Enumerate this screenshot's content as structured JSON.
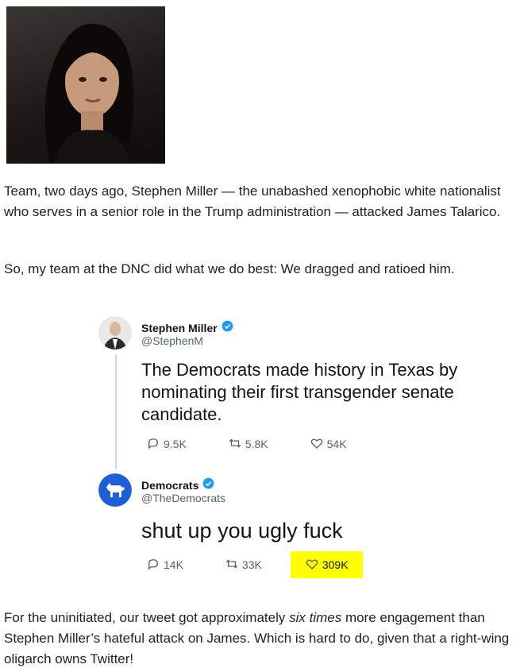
{
  "intro": {
    "paragraph1": "Team, two days ago, Stephen Miller — the unabashed xenophobic white nationalist who serves in a senior role in the Trump administration — attacked James Talarico.",
    "paragraph2": "So, my team at the DNC did what we do best: We dragged and ratioed him."
  },
  "tweets": [
    {
      "name": "Stephen Miller",
      "handle": "@StephenM",
      "text": "The Democrats made history in Texas by nominating their first transgender senate candidate.",
      "replies": "9.5K",
      "retweets": "5.8K",
      "likes": "54K"
    },
    {
      "name": "Democrats",
      "handle": "@TheDemocrats",
      "text": "shut up you ugly fuck",
      "replies": "14K",
      "retweets": "33K",
      "likes": "309K"
    }
  ],
  "outro": {
    "before": "For the uninitiated, our tweet got approximately ",
    "emphasis": "six times",
    "after": " more engagement than Stephen Miller’s hateful attack on James. Which is hard to do, given that a right-wing oligarch owns Twitter!"
  },
  "colors": {
    "verified": "#1d9bf0",
    "democrats_brand": "#1d5fd6",
    "highlight": "#ffff00"
  }
}
